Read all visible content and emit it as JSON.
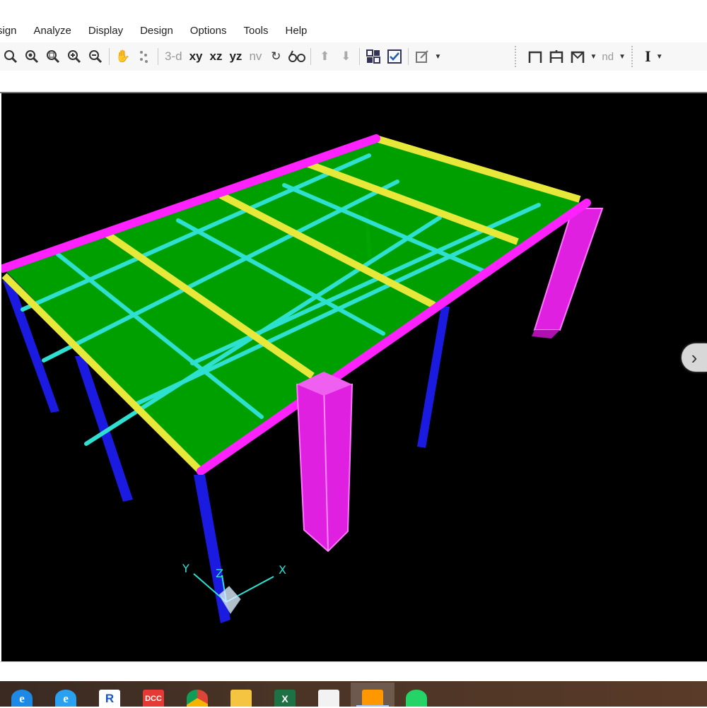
{
  "menu": [
    "sign",
    "Analyze",
    "Display",
    "Design",
    "Options",
    "Tools",
    "Help"
  ],
  "toolbar": {
    "view_3d": "3-d",
    "view_xy": "xy",
    "view_xz": "xz",
    "view_yz": "yz",
    "view_nv": "nv",
    "nd_label": "nd",
    "section_label": "I"
  },
  "axes": {
    "x": "X",
    "y": "Y",
    "z": "Z"
  },
  "model_colors": {
    "slab": "#00a800",
    "secondary_beam": "#2de0d0",
    "main_beam": "#e8e83a",
    "edge_beam": "#ff22ff",
    "column": "#1a1ae0",
    "wall_pier": "#e020e0"
  },
  "taskbar_icons": [
    "edge-icon",
    "ie-icon",
    "revit-icon",
    "dcc-icon",
    "chrome-icon",
    "file-explorer-icon",
    "excel-icon",
    "photos-icon",
    "etabs-icon",
    "whatsapp-icon"
  ]
}
